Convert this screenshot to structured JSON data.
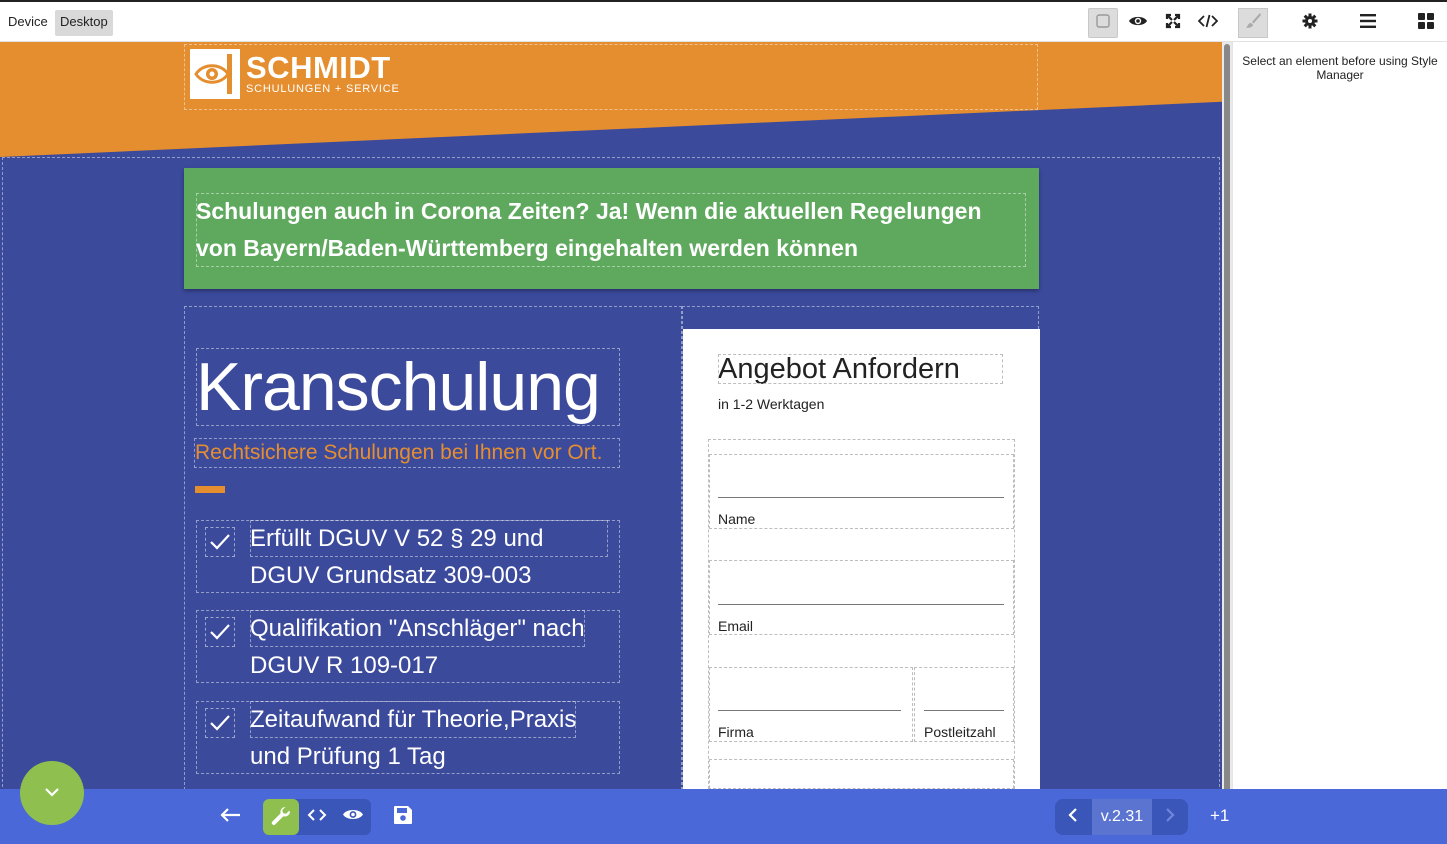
{
  "topbar": {
    "device_label": "Device",
    "device_value": "Desktop"
  },
  "right_panel": {
    "message": "Select an element before using Style Manager"
  },
  "page": {
    "logo": {
      "name": "SCHMIDT",
      "tagline": "SCHULUNGEN + SERVICE"
    },
    "banner": "Schulungen auch in Corona Zeiten? Ja! Wenn die aktuellen Regelungen von Bayern/Baden-Württemberg eingehalten werden können",
    "hero_title": "Kranschulung",
    "hero_subtitle": "Rechtsichere Schulungen bei Ihnen vor Ort.",
    "features": [
      {
        "line1": "Erfüllt DGUV V 52 § 29 und",
        "line2": "DGUV Grundsatz 309-003"
      },
      {
        "line1": "Qualifikation \"Anschläger\" nach",
        "line2": "DGUV R 109-017"
      },
      {
        "line1": "Zeitaufwand für Theorie,Praxis",
        "line2": "und Prüfung 1 Tag"
      }
    ],
    "form": {
      "title": "Angebot Anfordern",
      "subtitle": "in 1-2 Werktagen",
      "fields": {
        "name": "Name",
        "email": "Email",
        "firma": "Firma",
        "plz": "Postleitzahl"
      }
    }
  },
  "bottombar": {
    "version": "v.2.31",
    "plus": "+1"
  },
  "colors": {
    "brand_orange": "#e58e2f",
    "brand_blue": "#3c4a9c",
    "banner_green": "#5fa95e",
    "toolbar_blue": "#4a68d8",
    "action_green": "#8fc04f"
  }
}
